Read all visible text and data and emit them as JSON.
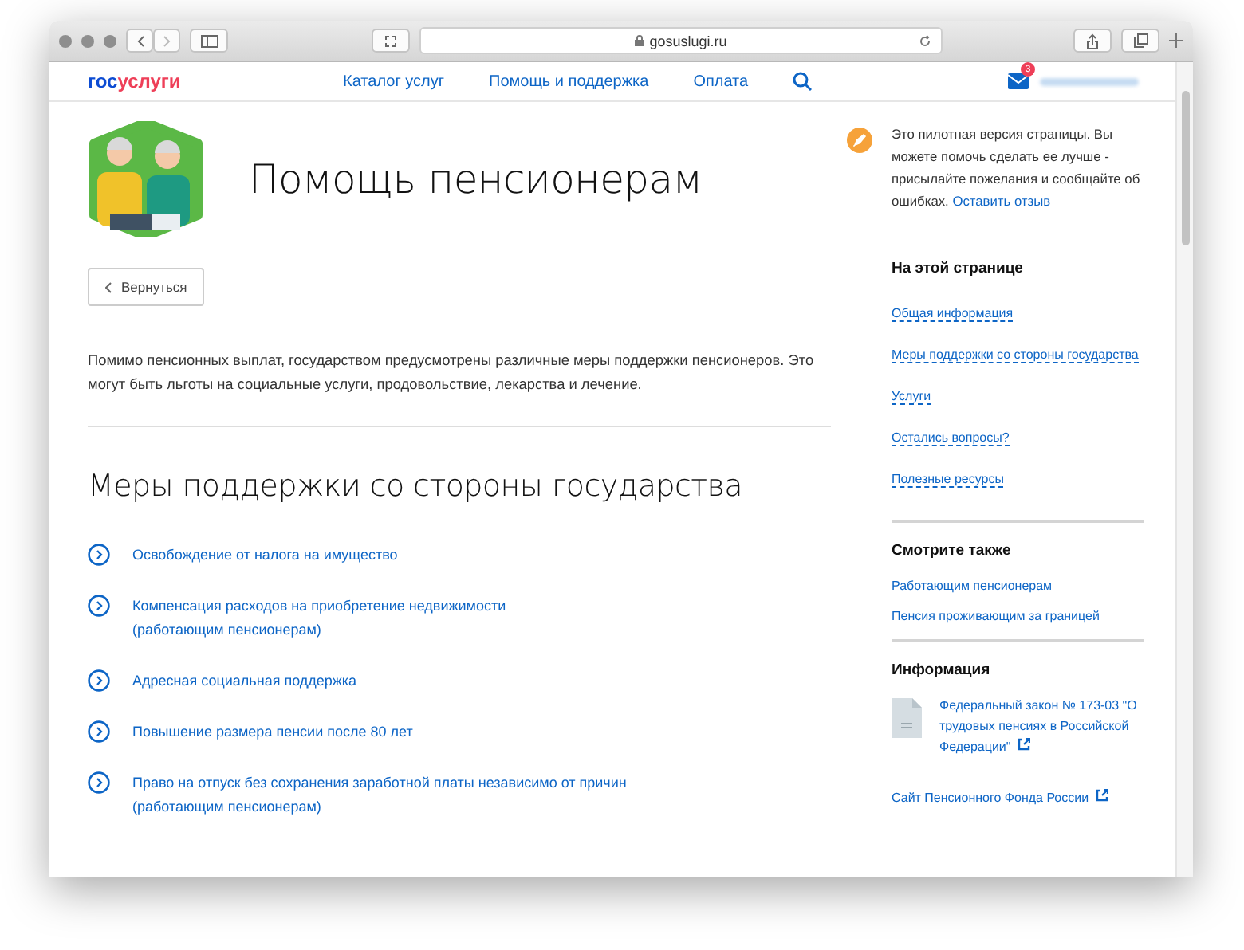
{
  "browser": {
    "url": "gosuslugi.ru"
  },
  "header": {
    "logo": [
      "гос",
      "услуги"
    ],
    "nav": [
      "Каталог услуг",
      "Помощь и поддержка",
      "Оплата"
    ],
    "mail_badge": "3"
  },
  "hero": {
    "title": "Помощь пенсионерам"
  },
  "back_button": "Вернуться",
  "intro": "Помимо пенсионных выплат, государством предусмотрены различные меры поддержки пенсионеров. Это могут быть льготы на социальные услуги, продовольствие, лекарства и лечение.",
  "section": {
    "title": "Меры поддержки со стороны государства",
    "items": [
      {
        "title": "Освобождение от налога на имущество"
      },
      {
        "title": "Компенсация расходов на приобретение недвижимости",
        "note": "(работающим пенсионерам)"
      },
      {
        "title": "Адресная социальная поддержка"
      },
      {
        "title": "Повышение размера пенсии после 80 лет"
      },
      {
        "title": "Право на отпуск без сохранения заработной платы независимо от причин",
        "note": "(работающим пенсионерам)"
      }
    ]
  },
  "sidebar": {
    "notice": {
      "text": "Это пилотная версия страницы. Вы можете помочь сделать ее лучше - присылайте пожелания и сообщайте об ошибках.",
      "link": "Оставить отзыв"
    },
    "on_this_page": {
      "title": "На этой странице",
      "links": [
        "Общая информация",
        "Меры поддержки со стороны государства",
        "Услуги",
        "Остались вопросы?",
        "Полезные ресурсы"
      ]
    },
    "see_also": {
      "title": "Смотрите также",
      "links": [
        "Работающим пенсионерам",
        "Пенсия проживающим за границей"
      ]
    },
    "info": {
      "title": "Информация",
      "document": "Федеральный закон № 173-03 \"О трудовых пенсиях в Российской Федерации\"",
      "site_link": "Сайт Пенсионного Фонда России"
    }
  }
}
